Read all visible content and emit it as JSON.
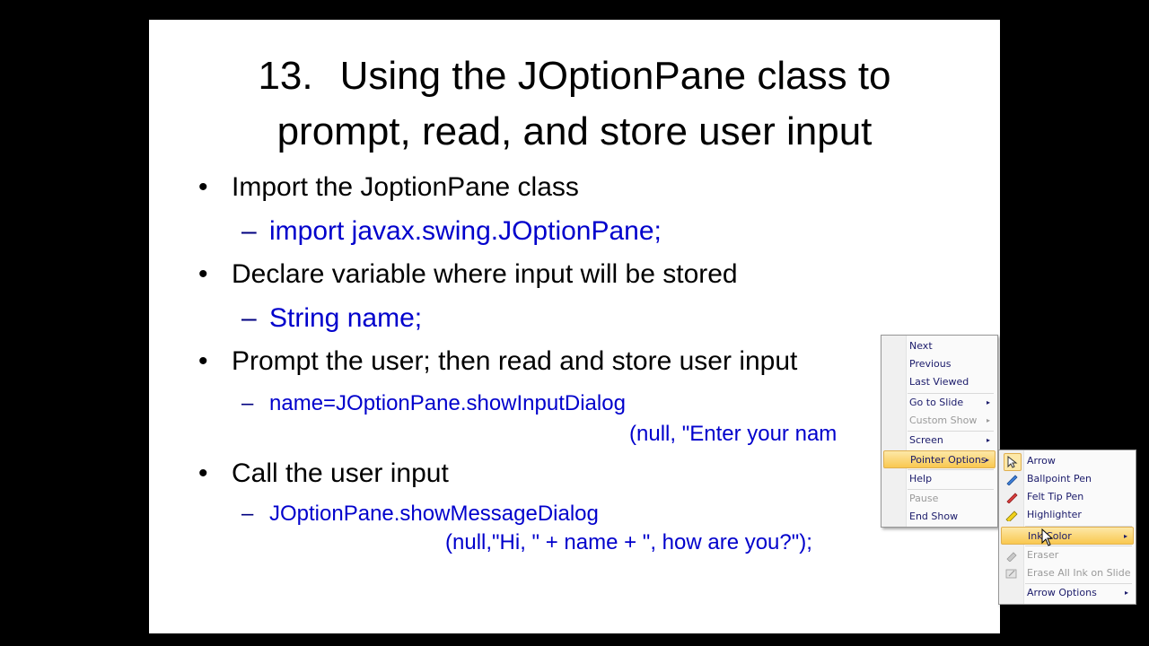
{
  "slide": {
    "title_number": "13.",
    "title_line1": "Using the JOptionPane class to",
    "title_line2": "prompt, read, and store user input",
    "bullet_glyph": "•",
    "dash_glyph": "–",
    "bullets": [
      {
        "text": "Import the JoptionPane class",
        "sub": "import javax.swing.JOptionPane;"
      },
      {
        "text": "Declare variable where input will be stored",
        "sub": "String name;"
      },
      {
        "text": "Prompt the user; then read and store user input",
        "sub": "name=JOptionPane.showInputDialog",
        "cont": "(null, \"Enter your nam"
      },
      {
        "text": "Call the user input",
        "sub": "JOptionPane.showMessageDialog",
        "cont": "(null,\"Hi, \" + name + \", how are you?\");"
      }
    ]
  },
  "context_menu": {
    "items": [
      {
        "label": "Next"
      },
      {
        "label": "Previous"
      },
      {
        "label": "Last Viewed"
      },
      {
        "label": "Go to Slide"
      },
      {
        "label": "Custom Show"
      },
      {
        "label": "Screen"
      },
      {
        "label": "Pointer Options"
      },
      {
        "label": "Help"
      },
      {
        "label": "Pause"
      },
      {
        "label": "End Show"
      }
    ],
    "submenu_arrow": "▸"
  },
  "pointer_submenu": {
    "items": [
      {
        "label": "Arrow",
        "icon": "arrow-pointer-icon"
      },
      {
        "label": "Ballpoint Pen",
        "icon": "ballpoint-pen-icon"
      },
      {
        "label": "Felt Tip Pen",
        "icon": "felt-tip-pen-icon"
      },
      {
        "label": "Highlighter",
        "icon": "highlighter-icon"
      },
      {
        "label": "Ink Color"
      },
      {
        "label": "Eraser",
        "icon": "eraser-icon"
      },
      {
        "label": "Erase All Ink on Slide",
        "icon": "erase-all-icon"
      },
      {
        "label": "Arrow Options"
      }
    ]
  },
  "colors": {
    "slide_bg": "#ffffff",
    "code_text": "#0000cc",
    "menu_highlight": "#f9c850"
  }
}
